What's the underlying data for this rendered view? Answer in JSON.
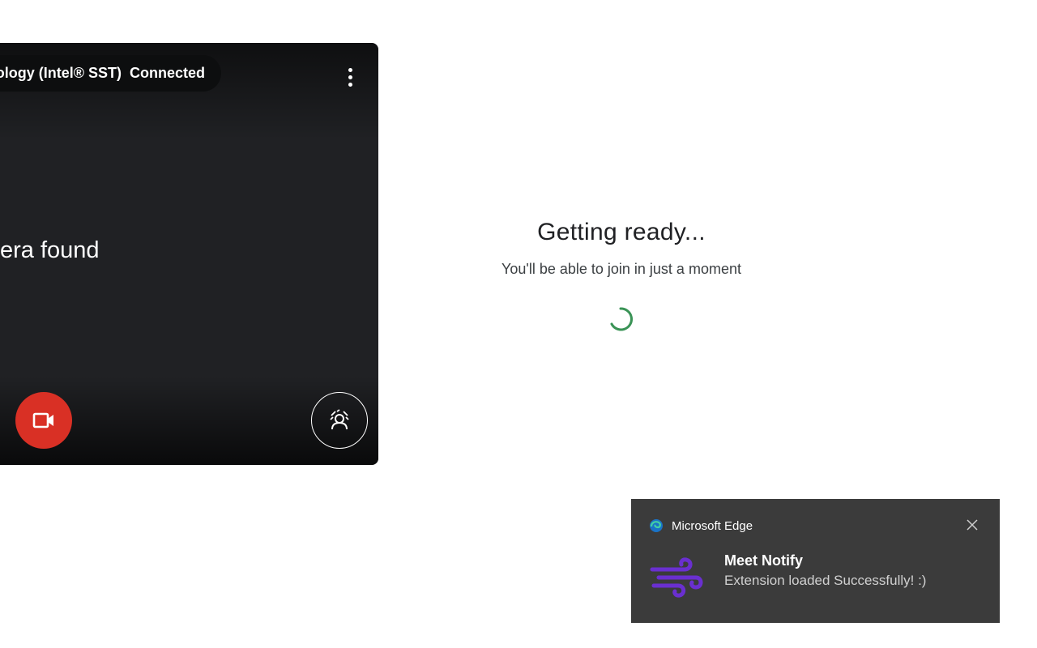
{
  "preview": {
    "device_label": "Intel® Smart Sound Technology (Intel® SST)",
    "device_label_visible": "nology (Intel® SST)",
    "device_status": "Connected",
    "camera_message": "No camera found",
    "camera_message_visible": "era found",
    "camera_button_color": "#d93025",
    "icons": {
      "more": "more-vert-icon",
      "camera": "videocam-icon",
      "effects": "visual-effects-icon"
    }
  },
  "ready": {
    "title": "Getting ready...",
    "subtitle": "You'll be able to join in just a moment",
    "spinner_color": "#188038"
  },
  "toast": {
    "app_name": "Microsoft Edge",
    "title": "Meet Notify",
    "body": "Extension loaded Successfully! :)",
    "icon_color": "#6a2fd0",
    "background": "#3b3b3b",
    "icons": {
      "app": "edge-logo-icon",
      "close": "close-icon",
      "extension": "wind-icon"
    }
  }
}
